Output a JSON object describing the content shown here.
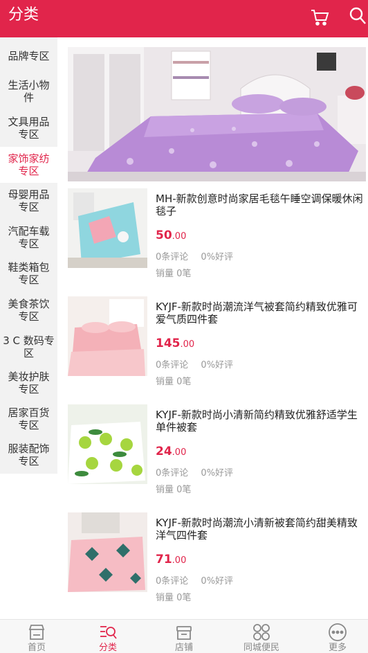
{
  "header": {
    "title": "分类"
  },
  "sidebar": {
    "items": [
      {
        "label": "品牌专区"
      },
      {
        "label": "生活小物件"
      },
      {
        "label": "文具用品专区"
      },
      {
        "label": "家饰家纺专区",
        "active": true
      },
      {
        "label": "母婴用品专区"
      },
      {
        "label": "汽配车载专区"
      },
      {
        "label": "鞋类箱包专区"
      },
      {
        "label": "美食茶饮专区"
      },
      {
        "label": "3 C 数码专区"
      },
      {
        "label": "美妆护肤专区"
      },
      {
        "label": "居家百货专区"
      },
      {
        "label": "服装配饰专区"
      }
    ]
  },
  "products": [
    {
      "title": "MH-新款创意时尚家居毛毯午睡空调保暖休闲毯子",
      "price_int": "50",
      "price_dec": ".00",
      "comments": "0条评论",
      "rating": "0%好评",
      "sales": "销量 0笔"
    },
    {
      "title": "KYJF-新款时尚潮流洋气被套简约精致优雅可爱气质四件套",
      "price_int": "145",
      "price_dec": ".00",
      "comments": "0条评论",
      "rating": "0%好评",
      "sales": "销量 0笔"
    },
    {
      "title": "KYJF-新款时尚小清新简约精致优雅舒适学生单件被套",
      "price_int": "24",
      "price_dec": ".00",
      "comments": "0条评论",
      "rating": "0%好评",
      "sales": "销量 0笔"
    },
    {
      "title": "KYJF-新款时尚潮流小清新被套简约甜美精致洋气四件套",
      "price_int": "71",
      "price_dec": ".00",
      "comments": "0条评论",
      "rating": "0%好评",
      "sales": "销量 0笔"
    }
  ],
  "tabs": [
    {
      "label": "首页",
      "icon": "home-icon"
    },
    {
      "label": "分类",
      "icon": "category-icon",
      "active": true
    },
    {
      "label": "店铺",
      "icon": "store-icon"
    },
    {
      "label": "同城便民",
      "icon": "grid-icon"
    },
    {
      "label": "更多",
      "icon": "more-icon"
    }
  ],
  "colors": {
    "accent": "#e1254b",
    "sidebar_bg": "#f2f2f2",
    "muted": "#999999"
  }
}
